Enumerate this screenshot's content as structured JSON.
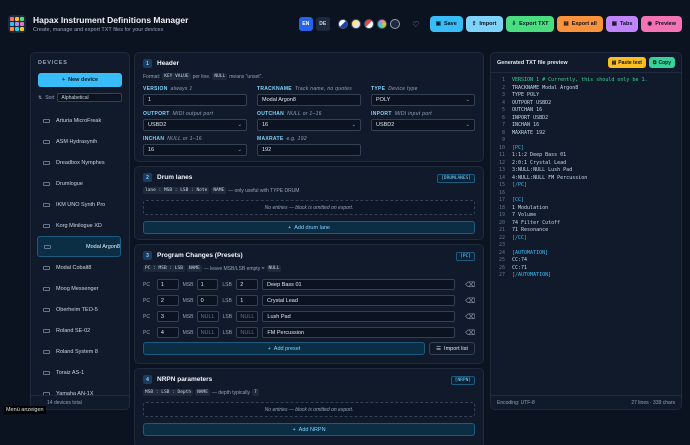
{
  "header": {
    "title": "Hapax Instrument Definitions Manager",
    "subtitle": "Create, manage and export TXT files for your devices",
    "lang": [
      "EN",
      "DE"
    ],
    "buttons": {
      "save": "Save",
      "import": "Import",
      "export_txt": "Export TXT",
      "export_all": "Export all",
      "tabs": "Tabs",
      "preview": "Preview"
    }
  },
  "sidebar": {
    "title": "DEVICES",
    "new_device": "New device",
    "sort_label": "Sort",
    "sort_value": "Alphabetical",
    "devices": [
      "Arturia MicroFreak",
      "ASM Hydrasynth",
      "Dreadbox Nymphes",
      "Drumlogue",
      "IKM UNO Synth Pro",
      "Korg Minilogue XD",
      "Modal Argon8",
      "Modal Cobalt8",
      "Moog Messenger",
      "Oberheim TEO-5",
      "Roland SE-02",
      "Roland System 8",
      "Toraiz AS-1",
      "Yamaha AN-1X"
    ],
    "selected": "Modal Argon8",
    "footer": "14 devices total"
  },
  "footer_menu": "Menü anzeigen",
  "header_card": {
    "num": "1",
    "title": "Header",
    "format_prefix": "Format:",
    "format_code": "KEY VALUE",
    "format_mid": "per line.",
    "null_code": "NULL",
    "format_suffix": "means \"unset\".",
    "fields": [
      {
        "label": "VERSION",
        "hint": "always 1",
        "value": "1"
      },
      {
        "label": "TRACKNAME",
        "hint": "Track name, no quotes",
        "value": "Modal Argon8"
      },
      {
        "label": "TYPE",
        "hint": "Device type",
        "value": "POLY",
        "select": true
      },
      {
        "label": "OUTPORT",
        "hint": "MIDI output port",
        "value": "USBD2",
        "select": true
      },
      {
        "label": "OUTCHAN",
        "hint": "NULL or 1–16",
        "value": "16",
        "select": true
      },
      {
        "label": "INPORT",
        "hint": "MIDI input port",
        "value": "USBD2",
        "select": true
      },
      {
        "label": "INCHAN",
        "hint": "NULL or 1–16",
        "value": "16",
        "select": true
      },
      {
        "label": "MAXRATE",
        "hint": "e.g. 192",
        "value": "192"
      }
    ]
  },
  "drum_card": {
    "num": "2",
    "title": "Drum lanes",
    "tag": "[DRUMLANES]",
    "format_code": "lane : MSB : LSB : Note",
    "name_code": "NAME",
    "format_suffix": "— only useful with TYPE DRUM",
    "empty": "No entries — block is omitted on export.",
    "add": "Add drum lane"
  },
  "pc_card": {
    "num": "3",
    "title": "Program Changes (Presets)",
    "tag": "[PC]",
    "format_code": "PC : MSB : LSB",
    "name_code": "NAME",
    "format_mid": "— leave MSB/LSB empty =",
    "null_code": "NULL",
    "labels": {
      "pc": "PC",
      "msb": "MSB",
      "lsb": "LSB"
    },
    "rows": [
      {
        "pc": "1",
        "msb": "1",
        "lsb": "2",
        "name": "Deep Bass 01"
      },
      {
        "pc": "2",
        "msb": "0",
        "lsb": "1",
        "name": "Crystal Lead"
      },
      {
        "pc": "3",
        "msb": "NULL",
        "lsb": "NULL",
        "name": "Lush Pad"
      },
      {
        "pc": "4",
        "msb": "NULL",
        "lsb": "NULL",
        "name": "FM Percussion"
      }
    ],
    "add": "Add preset",
    "import": "Import list"
  },
  "nrpn_card": {
    "num": "4",
    "title": "NRPN parameters",
    "tag": "[NRPN]",
    "format_code": "MSB : LSB : Depth",
    "name_code": "NAME",
    "format_mid": "— depth typically",
    "depth_code": "7",
    "empty": "No entries — block is omitted on export.",
    "add": "Add NRPN"
  },
  "preview": {
    "title": "Generated TXT file preview",
    "paste": "Paste text",
    "copy": "Copy",
    "lines": [
      {
        "t": "VERSION 1 # Currently, this should only be 1.",
        "k": "cm"
      },
      {
        "t": "TRACKNAME Modal Argon8",
        "k": ""
      },
      {
        "t": "TYPE POLY",
        "k": ""
      },
      {
        "t": "OUTPORT USBD2",
        "k": ""
      },
      {
        "t": "OUTCHAN 16",
        "k": ""
      },
      {
        "t": "INPORT USBD2",
        "k": ""
      },
      {
        "t": "INCHAN 16",
        "k": ""
      },
      {
        "t": "MAXRATE 192",
        "k": ""
      },
      {
        "t": "",
        "k": ""
      },
      {
        "t": "[PC]",
        "k": "hl"
      },
      {
        "t": "1:1:2 Deep Bass 01",
        "k": ""
      },
      {
        "t": "2:0:1 Crystal Lead",
        "k": ""
      },
      {
        "t": "3:NULL:NULL Lush Pad",
        "k": ""
      },
      {
        "t": "4:NULL:NULL FM Percussion",
        "k": ""
      },
      {
        "t": "[/PC]",
        "k": "hl"
      },
      {
        "t": "",
        "k": ""
      },
      {
        "t": "[CC]",
        "k": "hl"
      },
      {
        "t": "1 Modulation",
        "k": ""
      },
      {
        "t": "7 Volume",
        "k": ""
      },
      {
        "t": "74 Filter Cutoff",
        "k": ""
      },
      {
        "t": "71 Resonance",
        "k": ""
      },
      {
        "t": "[/CC]",
        "k": "hl"
      },
      {
        "t": "",
        "k": ""
      },
      {
        "t": "[AUTOMATION]",
        "k": "hl"
      },
      {
        "t": "CC:74",
        "k": ""
      },
      {
        "t": "CC:71",
        "k": ""
      },
      {
        "t": "[/AUTOMATION]",
        "k": "hl"
      }
    ],
    "encoding": "Encoding: UTF-8",
    "stats": "27 lines · 339 chars"
  },
  "colors": {
    "save": "#38bdf8",
    "import": "#7dd3fc",
    "export_txt": "#4ade80",
    "export_all": "#fb923c",
    "tabs": "#c084fc",
    "preview": "#f472b6",
    "paste": "#fbbf24",
    "copy": "#34d399"
  }
}
